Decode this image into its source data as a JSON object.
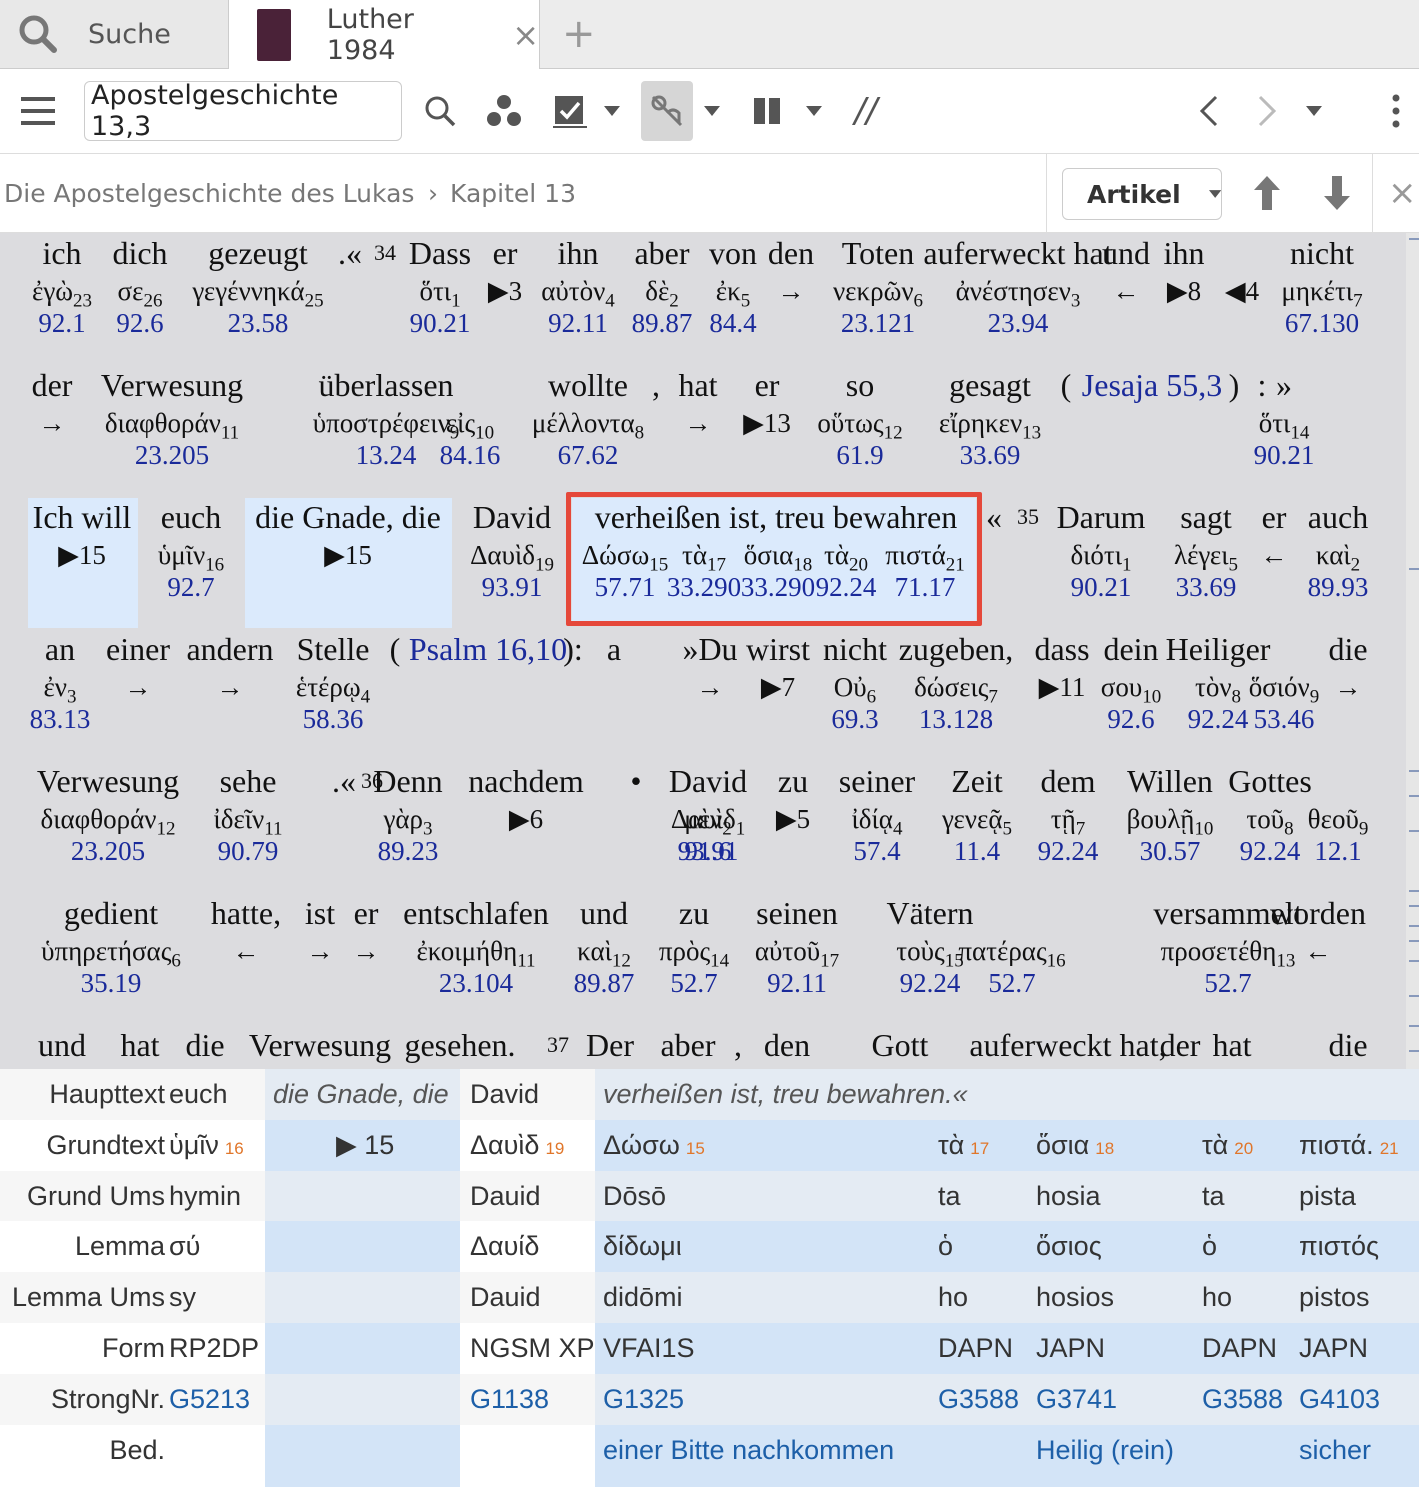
{
  "tabs": {
    "search_label": "Suche",
    "active_label": "Luther 1984",
    "close": "×",
    "new_tab": "+"
  },
  "toolbar": {
    "reference": "Apostelgeschichte 13,3",
    "parallel": "//"
  },
  "breadcrumb": {
    "book": "Die Apostelgeschichte des Lukas",
    "separator": "›",
    "chapter": "Kapitel 13",
    "view_select": "Artikel",
    "close": "×"
  },
  "reader": {
    "l1": [
      [
        "ich",
        "ἐγὼ",
        "23",
        "92.1"
      ],
      [
        "dich",
        "σε",
        "26",
        "92.6"
      ],
      [
        "gezeugt",
        "γεγέννηκά",
        "25",
        "23.58"
      ],
      [
        ".«",
        null,
        null,
        null
      ],
      [
        "34",
        "",
        "",
        ""
      ],
      [
        "Dass",
        "ὅτι",
        "1",
        "90.21"
      ],
      [
        "er",
        "▶3",
        "",
        ""
      ],
      [
        "ihn",
        "αὐτὸν",
        "4",
        "92.11"
      ],
      [
        "aber",
        "δὲ",
        "2",
        "89.87"
      ],
      [
        "von",
        "ἐκ",
        "5",
        "84.4"
      ],
      [
        "den",
        "→",
        "",
        ""
      ],
      [
        "Toten",
        "νεκρῶν",
        "6",
        "23.121"
      ],
      [
        "auferweckt hat",
        "ἀνέστησεν",
        "3",
        "23.94"
      ],
      [
        "und",
        "←",
        "",
        ""
      ],
      [
        "ihn",
        "▶8",
        "",
        ""
      ],
      [
        "",
        "◀4",
        "",
        ""
      ],
      [
        "nicht",
        "μηκέτι",
        "7",
        "67.130"
      ]
    ],
    "l2": [
      [
        "der",
        "→",
        "",
        ""
      ],
      [
        "Verwesung",
        "διαφθοράν",
        "11",
        "23.205"
      ],
      [
        "überlassen",
        "ὑποστρέφειν",
        "9",
        "13.24"
      ],
      [
        "",
        "εἰς",
        "10",
        "84.16"
      ],
      [
        "wollte",
        "μέλλοντα",
        "8",
        "67.62"
      ],
      [
        ",",
        "",
        ""
      ],
      [
        "hat",
        "→",
        "",
        ""
      ],
      [
        "er",
        "▶13",
        "",
        ""
      ],
      [
        "so",
        "οὕτως",
        "12",
        "61.9"
      ],
      [
        "gesagt",
        "εἴρηκεν",
        "13",
        "33.69"
      ],
      [
        "(",
        null,
        null,
        null
      ],
      [
        "Jesaja 55,3",
        null,
        null,
        null
      ],
      [
        ")",
        null,
        null,
        null
      ],
      [
        ":",
        "",
        ""
      ],
      [
        "»",
        "ὅτι",
        "14",
        "90.21"
      ]
    ],
    "l3": [
      [
        "Ich will",
        "▶15",
        "",
        ""
      ],
      [
        "euch",
        "ὑμῖν",
        "16",
        "92.7"
      ],
      [
        "die Gnade, die",
        "▶15",
        "",
        ""
      ],
      [
        "David",
        "Δαυὶδ",
        "19",
        "93.91"
      ],
      [
        "verheißen ist, treu bewahren",
        "",
        ""
      ],
      [
        "",
        "Δώσω",
        "15",
        "57.71"
      ],
      [
        "",
        "τὰ",
        "17",
        "33.290"
      ],
      [
        "",
        "ὅσια",
        "18",
        "33.290"
      ],
      [
        "",
        "τὰ",
        "20",
        "92.24"
      ],
      [
        "",
        "πιστά",
        "21",
        "71.17"
      ],
      [
        "«",
        null,
        null,
        null
      ],
      [
        "35",
        "",
        "",
        ""
      ],
      [
        "Darum",
        "διότι",
        "1",
        "90.21"
      ],
      [
        "sagt",
        "λέγει",
        "5",
        "33.69"
      ],
      [
        "er",
        "←",
        "",
        ""
      ],
      [
        "auch",
        "καὶ",
        "2",
        "89.93"
      ]
    ],
    "l4": [
      [
        "an",
        "ἐν",
        "3",
        "83.13"
      ],
      [
        "einer",
        "→",
        "",
        ""
      ],
      [
        "andern",
        "→",
        "",
        ""
      ],
      [
        "Stelle",
        "ἑτέρῳ",
        "4",
        "58.36"
      ],
      [
        "(",
        null,
        null,
        null
      ],
      [
        "Psalm 16,10",
        null,
        null,
        null
      ],
      [
        "):",
        null,
        null,
        null
      ],
      [
        "a",
        null,
        null,
        null
      ],
      [
        "»Du",
        "→",
        "",
        ""
      ],
      [
        "wirst",
        "▶7",
        "",
        ""
      ],
      [
        "nicht",
        "Οὐ",
        "6",
        "69.3"
      ],
      [
        "zugeben,",
        "δώσεις",
        "7",
        "13.128"
      ],
      [
        "dass",
        "▶11",
        "",
        ""
      ],
      [
        "dein",
        "σου",
        "10",
        "92.6"
      ],
      [
        "Heiliger",
        "τὸν",
        "8",
        "92.24"
      ],
      [
        "",
        "ὅσιόν",
        "9",
        "53.46"
      ],
      [
        "die",
        "→",
        "",
        ""
      ]
    ],
    "l5": [
      [
        "Verwesung",
        "διαφθοράν",
        "12",
        "23.205"
      ],
      [
        "sehe",
        "ἰδεῖν",
        "11",
        "90.79"
      ],
      [
        ".«",
        null,
        null,
        null
      ],
      [
        "36",
        "",
        "",
        ""
      ],
      [
        "Denn",
        "γὰρ",
        "3",
        "89.23"
      ],
      [
        "nachdem",
        "▶6",
        "",
        ""
      ],
      [
        "•",
        "",
        ""
      ],
      [
        "David",
        "μὲν",
        "2",
        "91.6"
      ],
      [
        "",
        "Δαυὶδ",
        "1",
        "93.91"
      ],
      [
        "zu",
        "▶5",
        "",
        ""
      ],
      [
        "seiner",
        "ἰδίᾳ",
        "4",
        "57.4"
      ],
      [
        "Zeit",
        "γενεᾷ",
        "5",
        "11.4"
      ],
      [
        "dem",
        "τῇ",
        "7",
        "92.24"
      ],
      [
        "Willen",
        "βουλῇ",
        "10",
        "30.57"
      ],
      [
        "Gottes",
        "τοῦ",
        "8",
        "92.24"
      ],
      [
        "",
        "θεοῦ",
        "9",
        "12.1"
      ]
    ],
    "l6": [
      [
        "gedient",
        "ὑπηρετήσας",
        "6",
        "35.19"
      ],
      [
        "hatte,",
        "←",
        "",
        ""
      ],
      [
        "ist",
        "→",
        "",
        ""
      ],
      [
        "er",
        "→",
        "",
        ""
      ],
      [
        "entschlafen",
        "ἐκοιμήθη",
        "11",
        "23.104"
      ],
      [
        "und",
        "καὶ",
        "12",
        "89.87"
      ],
      [
        "zu",
        "πρὸς",
        "14",
        "52.7"
      ],
      [
        "seinen",
        "αὐτοῦ",
        "17",
        "92.11"
      ],
      [
        "Vätern",
        "τοὺς",
        "15",
        "92.24"
      ],
      [
        "",
        "πατέρας",
        "16",
        "52.7"
      ],
      [
        "versammelt",
        "προσετέθη",
        "13",
        "52.7"
      ],
      [
        "worden",
        "←",
        "",
        ""
      ]
    ],
    "l7": [
      "und",
      "hat",
      "die",
      "Verwesung",
      "gesehen.",
      "37",
      "Der",
      "aber",
      ",",
      "den",
      "Gott",
      "auferweckt hat,",
      "der",
      "hat",
      "die"
    ]
  },
  "interlinear": {
    "labels": [
      "Haupttext",
      "Grundtext",
      "Grund Ums",
      "Lemma",
      "Lemma Ums",
      "Form",
      "StrongNr.",
      "Bed."
    ],
    "col_euch": [
      "euch",
      "ὑμῖν",
      "hymin",
      "σύ",
      "sy",
      "RP2DP",
      "G5213",
      ""
    ],
    "col_euch_sub": "16",
    "col_gnade": [
      "die Gnade, die",
      "▶ 15"
    ],
    "col_david": [
      "David",
      "Δαυὶδ",
      "Dauid",
      "Δαυίδ",
      "Dauid",
      "NGSM XP",
      "G1138",
      ""
    ],
    "col_david_sub": "19",
    "col_verh": [
      "verheißen ist, treu bewahren.«",
      "Δώσω",
      "Dōsō",
      "δίδωμι",
      "didōmi",
      "VFAI1S",
      "G1325",
      "einer Bitte nachkommen"
    ],
    "col_verh_sub": "15",
    "col_ta1": [
      "τὰ",
      "ta",
      "ὁ",
      "ho",
      "DAPN",
      "G3588"
    ],
    "col_ta1_sub": "17",
    "col_hosia": [
      "ὅσια",
      "hosia",
      "ὅσιος",
      "hosios",
      "JAPN",
      "G3741",
      "Heilig (rein)"
    ],
    "col_hosia_sub": "18",
    "col_ta2": [
      "τὰ",
      "ta",
      "ὁ",
      "ho",
      "DAPN",
      "G3588"
    ],
    "col_ta2_sub": "20",
    "col_pista": [
      "πιστά.",
      "pista",
      "πιστός",
      "pistos",
      "JAPN",
      "G4103",
      "sicher"
    ],
    "col_pista_sub": "21"
  },
  "colors": {
    "highlight": "#dbeafc",
    "strong_blue": "#1d5fa8",
    "number_blue": "#1a2a9a",
    "selection_border": "#e5483a",
    "reader_bg": "#dcdcdf"
  }
}
